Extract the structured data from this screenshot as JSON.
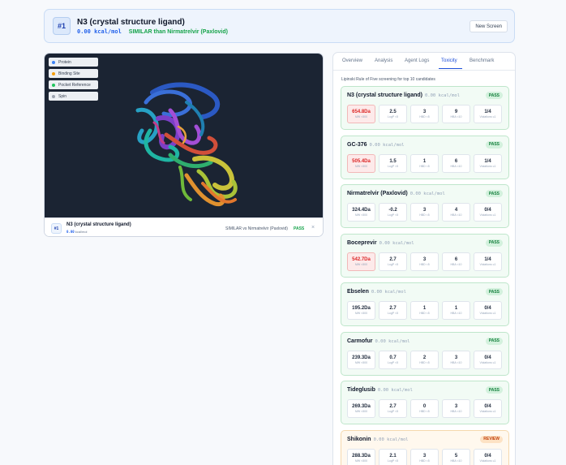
{
  "header": {
    "rank": "#1",
    "title": "N3 (crystal structure ligand)",
    "energy": "0.00 kcal/mol",
    "similarity": "SIMILAR than Nirmatrelvir (Paxlovid)",
    "new_screen_label": "New Screen"
  },
  "viewer": {
    "controls": [
      {
        "label": "Protein",
        "color": "#3b82f6"
      },
      {
        "label": "Binding Site",
        "color": "#f59e0b"
      },
      {
        "label": "Pocket Reference",
        "color": "#22c55e"
      },
      {
        "label": "Spin",
        "color": "#9ca3af"
      }
    ],
    "footer": {
      "rank": "#1",
      "title": "N3 (crystal structure ligand)",
      "energy_value": "0.00",
      "energy_unit": "kcal/mol",
      "similarity": "SIMILAR vs Nirmatrelvir (Paxlovid)",
      "status": "PASS",
      "close": "×"
    }
  },
  "tabs": [
    {
      "label": "Overview",
      "active": false
    },
    {
      "label": "Analysis",
      "active": false
    },
    {
      "label": "Agent Logs",
      "active": false
    },
    {
      "label": "Toxicity",
      "active": true
    },
    {
      "label": "Benchmark",
      "active": false
    }
  ],
  "toxicity": {
    "note": "Lipinski Rule of Five screening for top 10 candidates",
    "metric_labels": [
      "MW <500",
      "LogP <5",
      "HBD <5",
      "HBA <10",
      "Violations ≤1"
    ],
    "candidates": [
      {
        "name": "N3 (crystal structure ligand)",
        "energy": "0.00 kcal/mol",
        "status": "PASS",
        "mw": "654.8Da",
        "logp": "2.5",
        "hbd": "3",
        "hba": "9",
        "violations": "1/4",
        "mw_bad": true
      },
      {
        "name": "GC-376",
        "energy": "0.00 kcal/mol",
        "status": "PASS",
        "mw": "505.4Da",
        "logp": "1.5",
        "hbd": "1",
        "hba": "6",
        "violations": "1/4",
        "mw_bad": true
      },
      {
        "name": "Nirmatrelvir (Paxlovid)",
        "energy": "0.00 kcal/mol",
        "status": "PASS",
        "mw": "324.4Da",
        "logp": "-0.2",
        "hbd": "3",
        "hba": "4",
        "violations": "0/4",
        "mw_bad": false
      },
      {
        "name": "Boceprevir",
        "energy": "0.00 kcal/mol",
        "status": "PASS",
        "mw": "542.7Da",
        "logp": "2.7",
        "hbd": "3",
        "hba": "6",
        "violations": "1/4",
        "mw_bad": true
      },
      {
        "name": "Ebselen",
        "energy": "0.00 kcal/mol",
        "status": "PASS",
        "mw": "195.2Da",
        "logp": "2.7",
        "hbd": "1",
        "hba": "1",
        "violations": "0/4",
        "mw_bad": false
      },
      {
        "name": "Carmofur",
        "energy": "0.00 kcal/mol",
        "status": "PASS",
        "mw": "239.3Da",
        "logp": "0.7",
        "hbd": "2",
        "hba": "3",
        "violations": "0/4",
        "mw_bad": false
      },
      {
        "name": "Tideglusib",
        "energy": "0.00 kcal/mol",
        "status": "PASS",
        "mw": "269.3Da",
        "logp": "2.7",
        "hbd": "0",
        "hba": "3",
        "violations": "0/4",
        "mw_bad": false
      },
      {
        "name": "Shikonin",
        "energy": "0.00 kcal/mol",
        "status": "REVIEW",
        "mw": "288.3Da",
        "logp": "2.1",
        "hbd": "3",
        "hba": "5",
        "violations": "0/4",
        "mw_bad": false
      }
    ]
  }
}
